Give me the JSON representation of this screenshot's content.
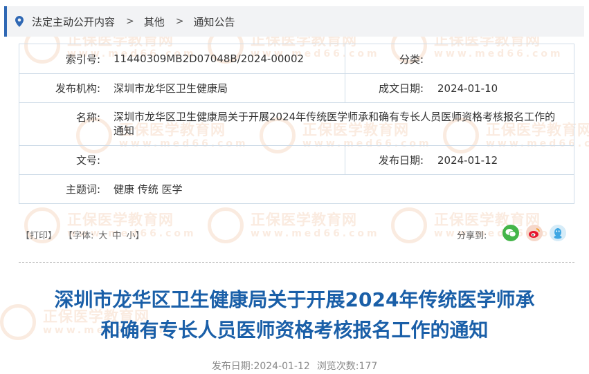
{
  "breadcrumb": {
    "items": [
      "法定主动公开内容",
      "其他",
      "通知公告"
    ],
    "separator": ">"
  },
  "info": {
    "index_label": "索引号:",
    "index_value": "11440309MB2D07048B/2024-00002",
    "category_label": "分类:",
    "category_value": "",
    "publisher_label": "发布机构:",
    "publisher_value": "深圳市龙华区卫生健康局",
    "written_date_label": "成文日期:",
    "written_date_value": "2024-01-10",
    "name_label": "名称:",
    "name_value": "深圳市龙华区卫生健康局关于开展2024年传统医学师承和确有专长人员医师资格考核报名工作的通知",
    "doc_no_label": "文号:",
    "doc_no_value": "",
    "publish_date_label": "发布日期:",
    "publish_date_value": "2024-01-12",
    "subject_label": "主题词:",
    "subject_value": "健康 传统 医学"
  },
  "tools": {
    "print": "【打印】",
    "font_prefix": "【字体:",
    "size_large": "大",
    "size_medium": "中",
    "size_small": "小】",
    "share_label": "分享到:"
  },
  "article": {
    "title_line1": "深圳市龙华区卫生健康局关于开展2024年传统医学师承",
    "title_line2": "和确有专长人员医师资格考核报名工作的通知",
    "date_label": "发布日期:",
    "date_value": "2024-01-12",
    "views_label": "浏览次数:",
    "views_value": "177"
  },
  "watermark": {
    "text": "正保医学教育网",
    "url": "www.med66.com"
  },
  "colors": {
    "accent": "#2f68b4",
    "title": "#1a5fa8",
    "border": "#cfdce8",
    "wechat": "#44b549",
    "weibo": "#e6162d",
    "qq": "#3fa7e3"
  },
  "icons": [
    "location-pin-icon",
    "wechat-icon",
    "weibo-icon",
    "qq-icon"
  ]
}
